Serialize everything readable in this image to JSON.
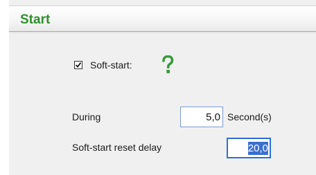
{
  "header": {
    "title": "Start"
  },
  "soft_start": {
    "label": "Soft-start:",
    "checked": true
  },
  "help": {
    "icon": "question-mark-icon",
    "color": "#3a9a3a"
  },
  "during": {
    "label": "During",
    "value": "5,0",
    "unit": "Second(s)"
  },
  "reset_delay": {
    "label": "Soft-start reset delay",
    "value": "20,0"
  },
  "colors": {
    "header_text": "#2f8f2f",
    "panel_bg": "#f0f0f0",
    "selection": "#3a6fd0"
  }
}
